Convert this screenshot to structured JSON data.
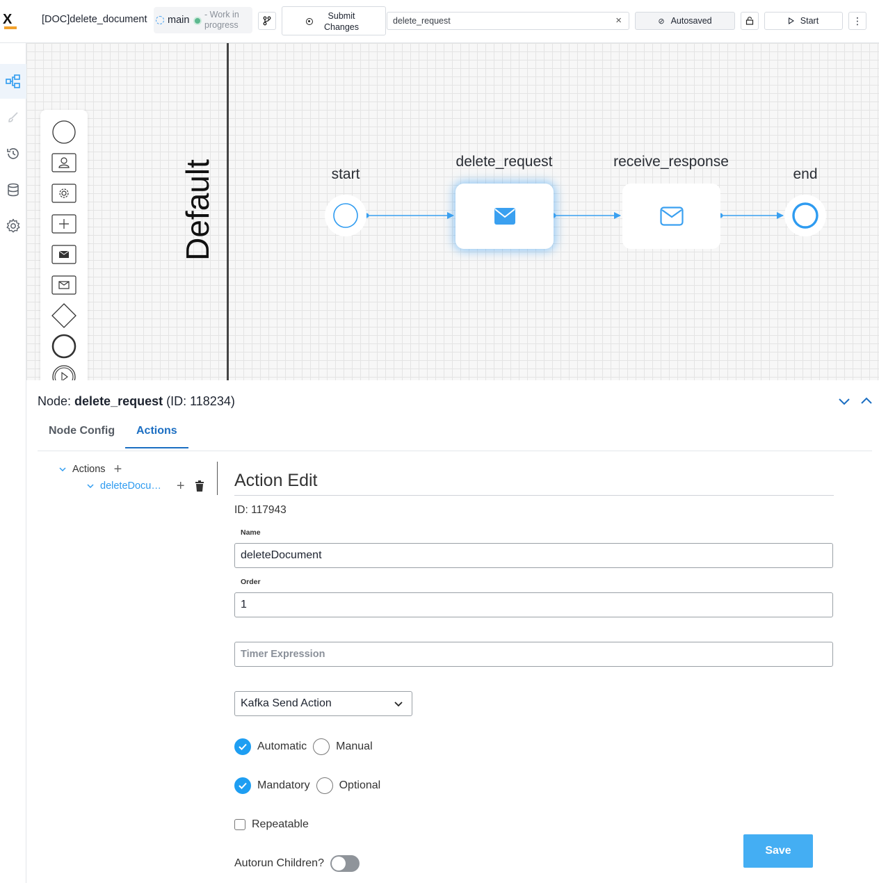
{
  "header": {
    "doc_title": "[DOC]delete_document",
    "branch": "main",
    "status": "- Work in progress",
    "submit_label": "Submit Changes",
    "search_value": "delete_request",
    "autosave_label": "Autosaved",
    "start_label": "Start"
  },
  "rail": {
    "items": [
      "diagram-icon",
      "brush-icon",
      "history-icon",
      "database-icon",
      "gear-icon"
    ]
  },
  "palette": {
    "items": [
      "start-event-icon",
      "user-task-icon",
      "service-task-icon",
      "subprocess-icon",
      "send-task-icon",
      "receive-task-icon",
      "gateway-icon",
      "end-event-icon",
      "timer-event-icon"
    ]
  },
  "diagram": {
    "lane": "Default",
    "nodes": {
      "start": "start",
      "task1": "delete_request",
      "task2": "receive_response",
      "end": "end"
    }
  },
  "node": {
    "prefix": "Node: ",
    "name": "delete_request",
    "id_text": " (ID: 118234)"
  },
  "tabs": [
    "Node Config",
    "Actions"
  ],
  "tree": {
    "root": "Actions",
    "child": "deleteDocu…"
  },
  "action_edit": {
    "title": "Action Edit",
    "id": "ID: 117943",
    "name_label": "Name",
    "name_value": "deleteDocument",
    "order_label": "Order",
    "order_value": "1",
    "timer_placeholder": "Timer Expression",
    "action_type": "Kafka Send Action",
    "trigger_options": [
      "Automatic",
      "Manual"
    ],
    "requirement_options": [
      "Mandatory",
      "Optional"
    ],
    "repeatable_label": "Repeatable",
    "autorun_label": "Autorun Children?",
    "save_label": "Save"
  },
  "colors": {
    "accent": "#1b6ec2",
    "flow": "#3aa0f0",
    "save": "#44aef3"
  }
}
